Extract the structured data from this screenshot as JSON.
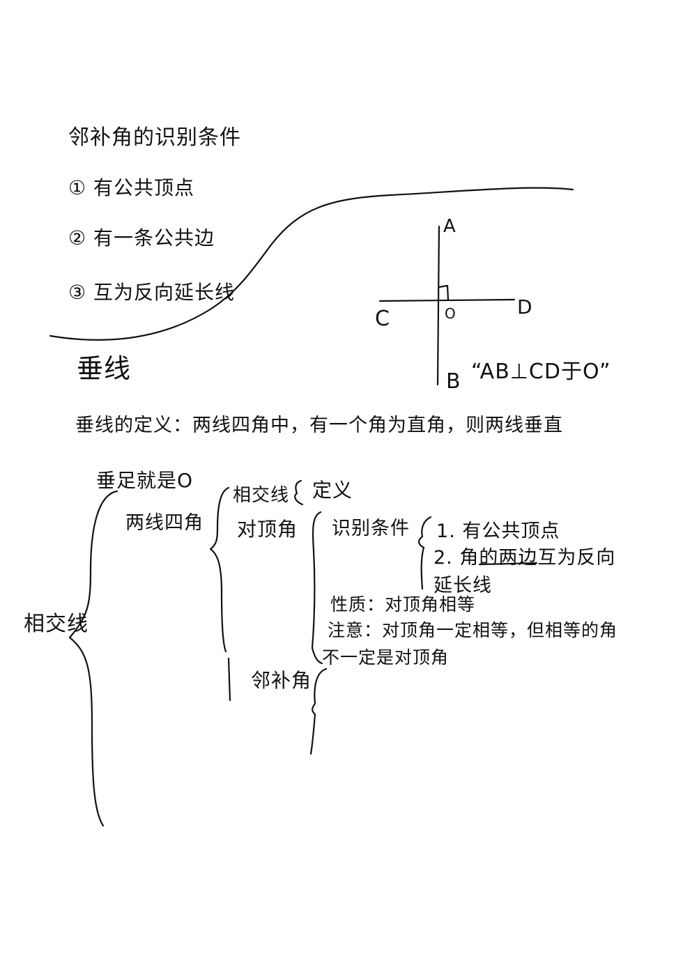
{
  "page": {
    "background": "#ffffff",
    "ink_color": "#111111"
  },
  "adjacent_supplementary": {
    "title": "邻补角的识别条件",
    "conditions": [
      "① 有公共顶点",
      "② 有一条公共边",
      "③ 互为反向延长线"
    ]
  },
  "perpendicular": {
    "heading": "垂线",
    "definition": "垂线的定义：两线四角中，有一个角为直角，则两线垂直",
    "figure": {
      "point_a": "A",
      "point_b": "B",
      "point_c": "C",
      "point_d": "D",
      "point_o": "O",
      "notation": "“AB⊥CD于O”"
    }
  },
  "mindmap": {
    "root": "相交线",
    "foot_note": "垂足就是O",
    "two_lines_four_angles": "两线四角",
    "intersecting_lines": "相交线",
    "definition": "定义",
    "vertical_angles": "对顶角",
    "identification": "识别条件",
    "id_condition_1": "1. 有公共顶点",
    "id_condition_2a": "2. 角的两边互为反向",
    "id_condition_2b": "延长线",
    "property": "性质：对顶角相等",
    "attention_1": "注意：对顶角一定相等，但相等的角",
    "attention_2": "不一定是对顶角",
    "adjacent_supplementary": "邻补角"
  }
}
